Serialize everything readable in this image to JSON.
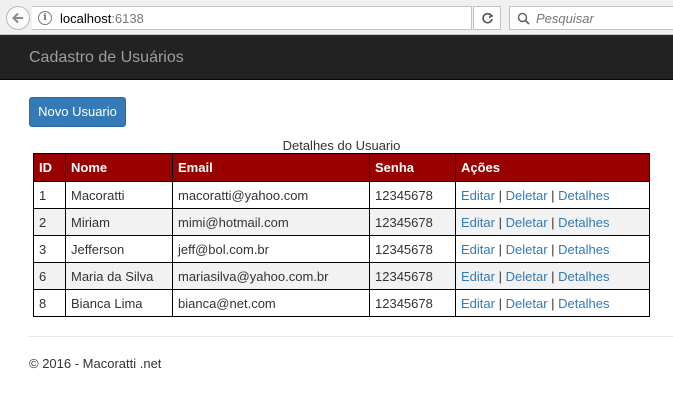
{
  "browser": {
    "url_host": "localhost",
    "url_port": ":6138",
    "search_placeholder": "Pesquisar"
  },
  "navbar": {
    "brand": "Cadastro de Usuários"
  },
  "toolbar": {
    "new_label": "Novo Usuario"
  },
  "table": {
    "caption": "Detalhes do Usuario",
    "headers": {
      "id": "ID",
      "nome": "Nome",
      "email": "Email",
      "senha": "Senha",
      "acoes": "Ações"
    },
    "action_labels": {
      "edit": "Editar",
      "delete": "Deletar",
      "details": "Detalhes",
      "separator": "|"
    },
    "rows": [
      {
        "id": "1",
        "nome": "Macoratti",
        "email": "macoratti@yahoo.com",
        "senha": "12345678"
      },
      {
        "id": "2",
        "nome": "Miriam",
        "email": "mimi@hotmail.com",
        "senha": "12345678"
      },
      {
        "id": "3",
        "nome": "Jefferson",
        "email": "jeff@bol.com.br",
        "senha": "12345678"
      },
      {
        "id": "6",
        "nome": "Maria da Silva",
        "email": "mariasilva@yahoo.com.br",
        "senha": "12345678"
      },
      {
        "id": "8",
        "nome": "Bianca Lima",
        "email": "bianca@net.com",
        "senha": "12345678"
      }
    ]
  },
  "footer": {
    "text": "© 2016 - Macoratti .net"
  },
  "colors": {
    "navbar": "#222222",
    "header_row": "#990000",
    "button": "#337ab7",
    "link": "#337ab7"
  }
}
